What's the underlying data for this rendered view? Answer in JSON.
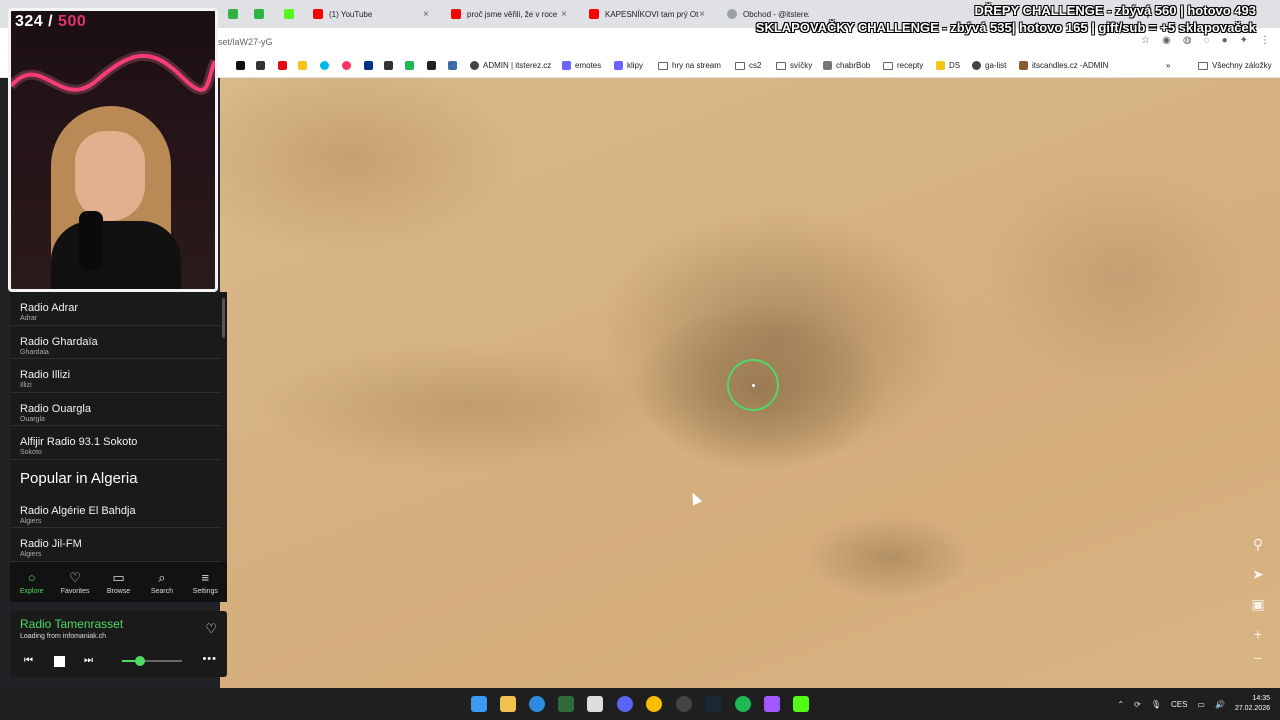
{
  "tabs": [
    {
      "label": "(1) YouTube",
      "color": "#ff0000"
    },
    {
      "label": "proč jsme věřili, že v roce",
      "color": "#ff0000"
    },
    {
      "label": "KAPESNÍKOVI tam prý Ot",
      "color": "#ff0000"
    },
    {
      "label": "Obchod - @itsterez",
      "color": "#9aa0a6"
    }
  ],
  "url": "set/laW27-yG",
  "bookmarks": [
    "ADMIN | itsterez.cz",
    "emotes",
    "klipy",
    "hry na stream",
    "cs2",
    "svíčky",
    "chabrBob",
    "recepty",
    "DS",
    "ga-list",
    "itscandles.cz -ADMIN",
    "Všechny záložky"
  ],
  "counter": {
    "current": "324",
    "separator": " / ",
    "total": "500"
  },
  "challenge": {
    "line1": "DŘEPY CHALLENGE - zbývá 560 | hotovo 493",
    "line2": "SKLAPOVAČKY CHALLENGE - zbývá 535| hotovo 165 | gift/sub = +5 sklapovaček"
  },
  "stations": [
    {
      "name": "Radio Adrar",
      "city": "Adrar"
    },
    {
      "name": "Radio Ghardaïa",
      "city": "Ghardaia"
    },
    {
      "name": "Radio Illizi",
      "city": "Illizi"
    },
    {
      "name": "Radio Ouargla",
      "city": "Ouargla"
    },
    {
      "name": "Alfijir Radio 93.1 Sokoto",
      "city": "Sokoto"
    }
  ],
  "popular_title": "Popular in Algeria",
  "popular": [
    {
      "name": "Radio Algérie El Bahdja",
      "city": "Algiers"
    },
    {
      "name": "Radio Jil-FM",
      "city": "Algiers"
    }
  ],
  "nav": [
    {
      "label": "Explore",
      "icon": "○"
    },
    {
      "label": "Favorites",
      "icon": "♡"
    },
    {
      "label": "Browse",
      "icon": "▭"
    },
    {
      "label": "Search",
      "icon": "⌕"
    },
    {
      "label": "Settings",
      "icon": "≡"
    }
  ],
  "player": {
    "title": "Radio Tamenrasset",
    "subtitle": "Loading from infomaniak.ch",
    "volume": 0.3
  },
  "clock": {
    "time": "14:35",
    "date": "27.02.2026"
  },
  "language": "CES",
  "accent": "#4cd964"
}
